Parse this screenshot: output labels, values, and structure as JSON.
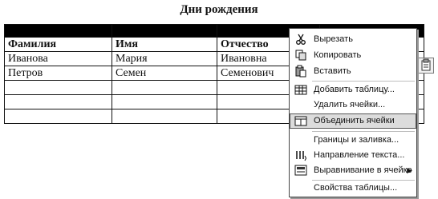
{
  "document": {
    "title": "Дни рождения",
    "columns": [
      "Фамилия",
      "Имя",
      "Отчество",
      ""
    ],
    "rows": [
      [
        "Иванова",
        "Мария",
        "Ивановна",
        ""
      ],
      [
        "Петров",
        "Семен",
        "Семенович",
        ""
      ],
      [
        "",
        "",
        "",
        ""
      ],
      [
        "",
        "",
        "",
        ""
      ],
      [
        "",
        "",
        "",
        ""
      ]
    ]
  },
  "context_menu": {
    "items": [
      {
        "label": "Вырезать",
        "icon": "scissors-icon"
      },
      {
        "label": "Копировать",
        "icon": "copy-icon"
      },
      {
        "label": "Вставить",
        "icon": "paste-icon"
      },
      {
        "label": "Добавить таблицу...",
        "icon": "insert-table-icon"
      },
      {
        "label": "Удалить ячейки...",
        "icon": ""
      },
      {
        "label": "Объединить ячейки",
        "icon": "merge-cells-icon",
        "highlighted": true
      },
      {
        "label": "Границы и заливка...",
        "icon": ""
      },
      {
        "label": "Направление текста...",
        "icon": "text-direction-icon"
      },
      {
        "label": "Выравнивание в ячейке",
        "icon": "cell-alignment-icon",
        "submenu": true
      },
      {
        "label": "Свойства таблицы...",
        "icon": ""
      }
    ]
  }
}
